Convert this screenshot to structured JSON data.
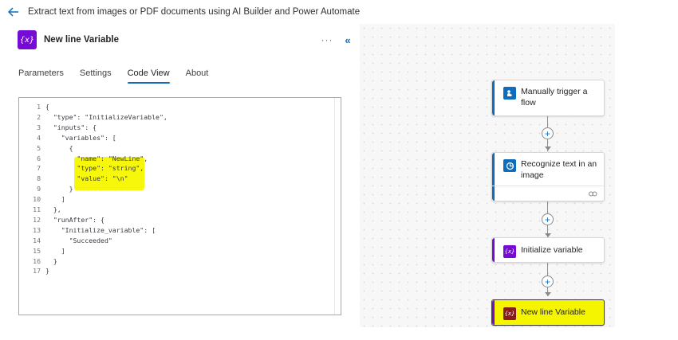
{
  "header": {
    "back_icon": "arrow-left-icon",
    "title": "Extract text from images or PDF documents using AI Builder and Power Automate"
  },
  "panel": {
    "icon_text": "{x}",
    "title": "New line Variable",
    "more_label": "···",
    "collapse_label": "«",
    "tabs": [
      {
        "label": "Parameters",
        "active": false
      },
      {
        "label": "Settings",
        "active": false
      },
      {
        "label": "Code View",
        "active": true
      },
      {
        "label": "About",
        "active": false
      }
    ],
    "code_lines": [
      {
        "n": "1",
        "text": "{"
      },
      {
        "n": "2",
        "text": "  \"type\": \"InitializeVariable\","
      },
      {
        "n": "3",
        "text": "  \"inputs\": {"
      },
      {
        "n": "4",
        "text": "    \"variables\": ["
      },
      {
        "n": "5",
        "text": "      {"
      },
      {
        "n": "6",
        "text": "        \"name\": \"NewLine\","
      },
      {
        "n": "7",
        "text": "        \"type\": \"string\","
      },
      {
        "n": "8",
        "text": "        \"value\": \"\\n\""
      },
      {
        "n": "9",
        "text": "      }"
      },
      {
        "n": "10",
        "text": "    ]"
      },
      {
        "n": "11",
        "text": "  },"
      },
      {
        "n": "12",
        "text": "  \"runAfter\": {"
      },
      {
        "n": "13",
        "text": "    \"Initialize_variable\": ["
      },
      {
        "n": "14",
        "text": "      \"Succeeded\""
      },
      {
        "n": "15",
        "text": "    ]"
      },
      {
        "n": "16",
        "text": "  }"
      },
      {
        "n": "17",
        "text": "}"
      }
    ]
  },
  "flow": {
    "cards": [
      {
        "label": "Manually trigger a flow",
        "icon": "trigger-icon",
        "accent": "#0f6cbd"
      },
      {
        "label": "Recognize text in an image",
        "icon": "ai-builder-icon",
        "accent": "#0f6cbd",
        "footer_icon": "link-icon"
      },
      {
        "label": "Initialize variable",
        "icon_text": "{x}",
        "accent": "#770BD6"
      },
      {
        "label": "New line Variable",
        "icon_text": "{x}",
        "accent": "#770BD6",
        "selected": true
      }
    ],
    "add_symbol": "+"
  },
  "colors": {
    "brand_blue": "#0f6cbd",
    "variable_purple": "#770BD6",
    "highlight_yellow": "#f7f70c"
  }
}
